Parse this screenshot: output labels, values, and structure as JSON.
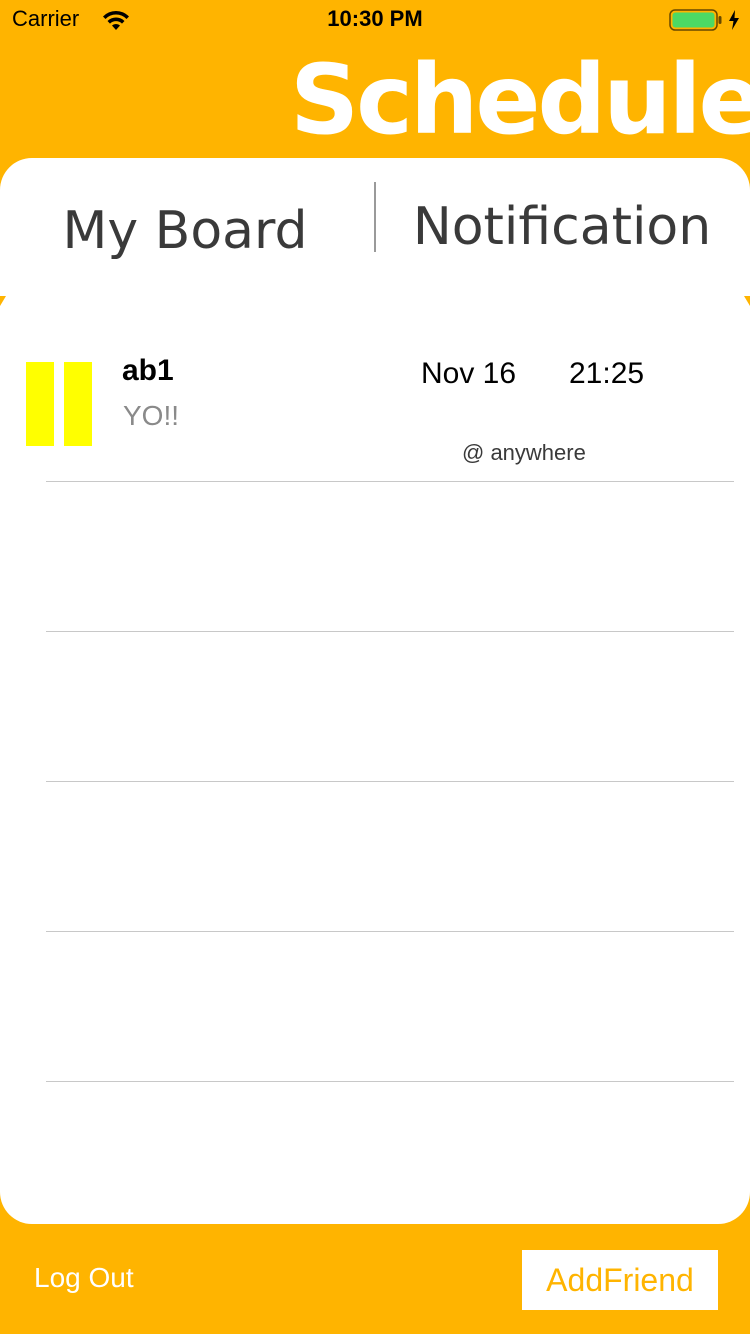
{
  "status_bar": {
    "carrier": "Carrier",
    "time": "10:30 PM",
    "icons": [
      "wifi-icon",
      "battery-icon",
      "charging-icon"
    ]
  },
  "header": {
    "title": "Schedule"
  },
  "tabs": [
    {
      "label": "My Board"
    },
    {
      "label": "Notification"
    }
  ],
  "schedule": {
    "items": [
      {
        "title": "ab1",
        "message": "YO!!",
        "date": "Nov 16",
        "time": "21:25",
        "location": "@ anywhere",
        "marker_color": "#FFFF00"
      }
    ]
  },
  "footer": {
    "logout_label": "Log Out",
    "addfriend_label": "AddFriend"
  },
  "colors": {
    "accent": "#FFB400",
    "marker": "#FFFF00",
    "card": "#FFFFFF"
  }
}
